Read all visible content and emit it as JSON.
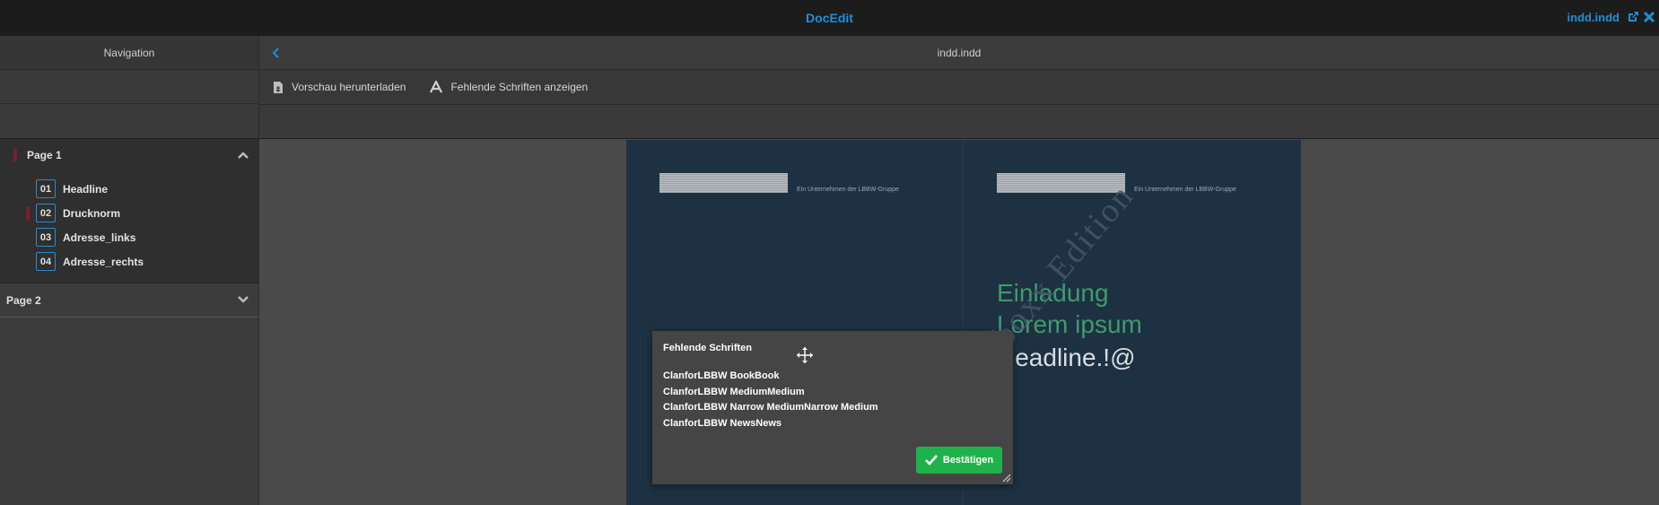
{
  "app": {
    "title": "DocEdit",
    "document_name": "indd.indd"
  },
  "sidebar": {
    "header": "Navigation",
    "pages": [
      {
        "label": "Page 1",
        "expanded": true,
        "items": [
          {
            "num": "01",
            "label": "Headline"
          },
          {
            "num": "02",
            "label": "Drucknorm"
          },
          {
            "num": "03",
            "label": "Adresse_links"
          },
          {
            "num": "04",
            "label": "Adresse_rechts"
          }
        ]
      },
      {
        "label": "Page 2",
        "expanded": false
      }
    ]
  },
  "main": {
    "file_title": "indd.indd",
    "toolbar": {
      "download_preview": "Vorschau herunterladen",
      "show_missing_fonts": "Fehlende Schriften anzeigen"
    }
  },
  "document": {
    "left_tagline": "Ein Unternehmen der LBBW-Gruppe",
    "right_tagline": "Ein Unternehmen der LBBW-Gruppe",
    "headline_1": "Einladung",
    "headline_2": "Lorem ipsum",
    "headline_3": "Headline.!@",
    "watermark": "Pixelboxx Edition"
  },
  "dialog": {
    "title": "Fehlende Schriften",
    "fonts": [
      "ClanforLBBW BookBook",
      "ClanforLBBW MediumMedium",
      "ClanforLBBW Narrow MediumNarrow Medium",
      "ClanforLBBW NewsNews"
    ],
    "confirm_label": "Bestätigen"
  },
  "colors": {
    "accent": "#1f8fd6",
    "confirm": "#1fb24a",
    "marker": "#7a1f2c",
    "page_bg": "#1e3142"
  }
}
